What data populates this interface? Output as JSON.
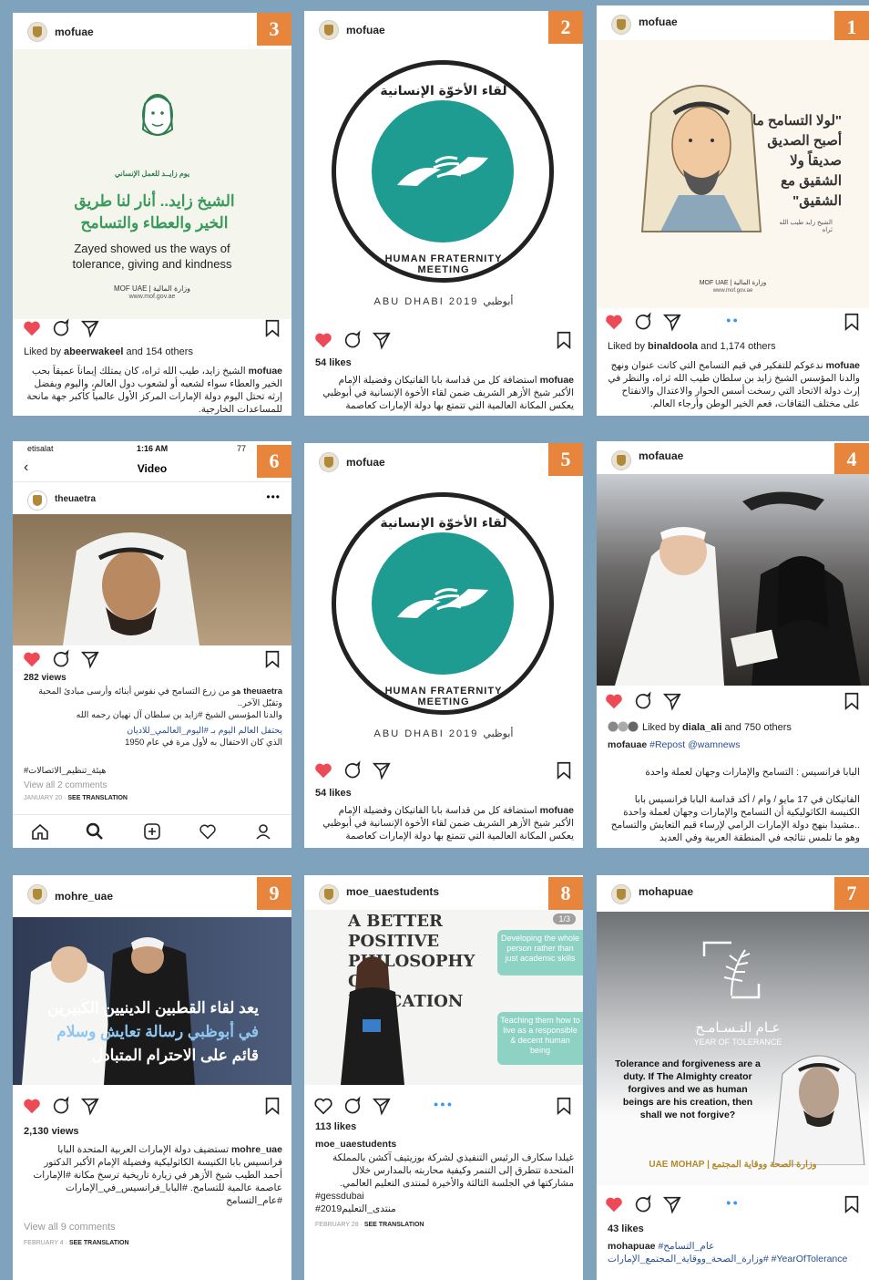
{
  "colors": {
    "badge": "#e8853d",
    "teal": "#1f9c91",
    "heart": "#ed4956",
    "link": "#2a4f8f"
  },
  "posts": [
    {
      "num": "3",
      "user": "mofuae",
      "img": {
        "ar_title": "الشيخ زايد.. أنار لنا طريق الخير والعطاء والتسامح",
        "en": "Zayed showed us the ways of tolerance, giving and kindness",
        "small": "يوم زايــد للعمل الإنساني",
        "footer": "MOF UAE | وزارة المالية",
        "site": "www.mof.gov.ae"
      },
      "likes_prefix": "Liked by",
      "likes_user": "abeerwakeel",
      "likes_suffix": "and 154 others",
      "cap_user": "mofuae",
      "caption": "الشيخ زايد، طيب الله ثراه، كان يمتلك إيماناً عميقاً بحب الخير والعطاء سواء لشعبه أو لشعوب دول العالم، واليوم وبفضل إرثه تحتل اليوم دولة الإمارات المركز الأول عالمياً كأكبر جهة مانحة للمساعدات الخارجية."
    },
    {
      "num": "2",
      "user": "mofuae",
      "img": {
        "ar_ring": "لقاء الأخوّة الإنسانية",
        "en_ring": "HUMAN FRATERNITY MEETING",
        "footer": "ABU DHABI 2019 أبوظبي"
      },
      "likes": "54 likes",
      "cap_user": "mofuae",
      "caption": "استضافة كل من قداسة بابا الفاتيكان وفضيلة الإمام الأكبر شيخ الأزهر الشريف ضمن لقاء الأخوة الإنسانية في أبوظبي يعكس المكانة العالمية التي تتمتع بها دولة الإمارات كعاصمة"
    },
    {
      "num": "1",
      "user": "mofuae",
      "img": {
        "quote": "\"لولا التسامح ما أصبح الصديق صديقاً ولا الشقيق مع الشقيق\"",
        "sig": "الشيخ زايد طيب الله ثراه",
        "footer": "MOF UAE | وزارة المالية",
        "site": "www.mof.gov.ae"
      },
      "likes_prefix": "Liked by",
      "likes_user": "binaldoola",
      "likes_suffix": "and 1,174 others",
      "cap_user": "mofuae",
      "caption": "ندعوكم للتفكير في قيم التسامح التي كانت عنوان ونهج والدنا المؤسس الشيخ زايد بن سلطان طيب الله ثراه، والنظر في إرث دولة الاتحاد التي رسخت أسس الحوار والاعتدال والانفتاح على مختلف الثقافات، فعم الخير الوطن وأرجاء العالم."
    },
    {
      "num": "6",
      "user": "theuaetra",
      "status": {
        "carrier": "etisalat",
        "time": "1:16 AM",
        "battery": "77"
      },
      "nav_title": "Video",
      "views": "282 views",
      "cap_user": "theuaetra",
      "caption_l1": "هو من زرع التسامح في نفوس أبنائه وأرسى مبادئ المحبة وتقبّل الآخر..",
      "caption_l2": "والدنا المؤسس الشيخ #زايد بن سلطان آل نهيان رحمه الله",
      "caption_l3": "يحتفل العالم اليوم بـ #اليوم_العالمي_للاديان",
      "caption_l4": "الذي كان الاحتفال به لأول مرة في عام 1950",
      "hashtag": "#هيئة_تنظيم_الاتصالات",
      "comments": "View all 2 comments",
      "date": "JANUARY 20",
      "translate": "SEE TRANSLATION"
    },
    {
      "num": "5",
      "user": "mofuae",
      "img": {
        "ar_ring": "لقاء الأخوّة الإنسانية",
        "en_ring": "HUMAN FRATERNITY MEETING",
        "footer": "ABU DHABI 2019 أبوظبي"
      },
      "likes": "54 likes",
      "cap_user": "mofuae",
      "caption": "استضافة كل من قداسة بابا الفاتيكان وفضيلة الإمام الأكبر شيخ الأزهر الشريف ضمن لقاء الأخوة الإنسانية في أبوظبي يعكس المكانة العالمية التي تتمتع بها دولة الإمارات كعاصمة"
    },
    {
      "num": "4",
      "user": "mofauae",
      "likes_prefix": "Liked by",
      "likes_user": "diala_ali",
      "likes_suffix": "and 750 others",
      "cap_user": "mofauae",
      "cap_tag": "#Repost @wamnews",
      "cap_l1": "البابا فرانسيس : التسامح والإمارات وجهان لعملة واحدة",
      "caption": "الفاتيكان في 17 مايو / وام / أكد قداسة البابا فرانسيس بابا الكنيسة الكاثوليكية أن التسامح والإمارات وجهان لعملة واحدة ..مشيدا بنهج دولة الإمارات الرامي لإرساء قيم التعايش والتسامح وهو ما تلمس نتائجه في المنطقة العربية وفي العديد"
    },
    {
      "num": "9",
      "user": "mohre_uae",
      "img": {
        "l1": "يعد لقاء القطبين الدينيين الكبيرين",
        "l2": "في أبوظبي رسالة تعايش وسلام",
        "l3": "قائم على الاحترام المتبادل"
      },
      "views": "2,130 views",
      "cap_user": "mohre_uae",
      "caption": "تستضيف دولة الإمارات العربية المتحدة البابا فرانسيس بابا الكنيسة الكاثوليكية وفضيلة الإمام الأكبر الدكتور أحمد الطيب شيخ الأزهر في زيارة تاريخية ترسخ مكانة #الإمارات عاصمة عالمية للتسامح. #البابا_فرانسيس_في_الإمارات #عام_التسامح",
      "comments": "View all 9 comments",
      "date": "FEBRUARY 4",
      "translate": "SEE TRANSLATION"
    },
    {
      "num": "8",
      "user": "moe_uaestudents",
      "img": {
        "l1": "A BETTER",
        "l2": "POSITIVE",
        "l3": "PHILOSOPHY",
        "l4": "OF",
        "l5": "EDUCATION",
        "box1": "Developing the whole person rather than just academic skills",
        "box2": "Teaching them how to live as a responsible & decent human being",
        "counter": "1/3"
      },
      "likes": "113 likes",
      "cap_user": "moe_uaestudents",
      "caption": "غيلدا سكارف الرئيس التنفيذي لشركة بوزيتيف آكشن بالمملكة المتحدة تتطرق إلى التنمر وكيفية محاربته بالمدارس خلال مشاركتها في الجلسة الثالثة والأخيرة لمنتدى التعليم العالمي.",
      "tags": "#gessdubai #منتدى_التعليم2019",
      "date": "FEBRUARY 28",
      "translate": "SEE TRANSLATION"
    },
    {
      "num": "7",
      "user": "mohapuae",
      "img": {
        "ar": "عـام التـسـامـح",
        "en": "YEAR OF TOLERANCE",
        "quote": "Tolerance and forgiveness are a duty. If The Almighty creator forgives and we as human beings are his creation, then shall we not forgive?",
        "footer": "UAE MOHAP | وزارة الصحة ووقاية المجتمع"
      },
      "likes": "43 likes",
      "cap_user": "mohapuae",
      "caption": "#عام_التسامح #وزارة_الصحة_ووقاية_المجتمع_الإمارات #YearOfTolerance"
    }
  ]
}
